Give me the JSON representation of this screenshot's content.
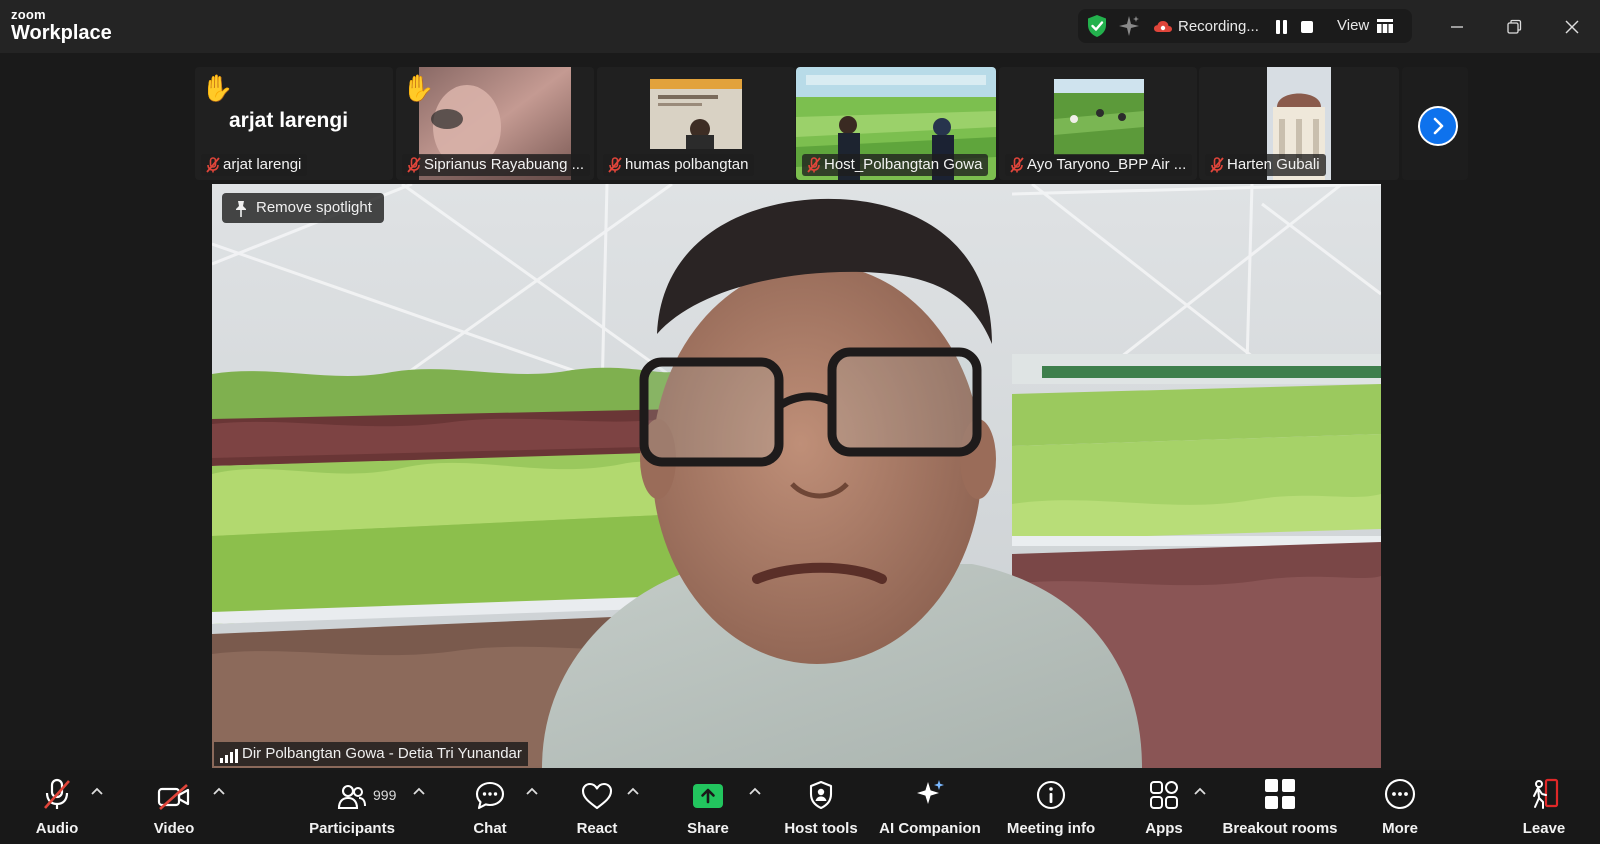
{
  "app": {
    "brand_small": "zoom",
    "brand_large": "Workplace"
  },
  "recording": {
    "status": "Recording...",
    "view_label": "View"
  },
  "filmstrip": {
    "tiles": [
      {
        "name": "arjat larengi",
        "display_name": "arjat larengi",
        "hand_raised": true,
        "muted": true
      },
      {
        "name": "Siprianus Rayabuang ...",
        "hand_raised": true,
        "muted": true
      },
      {
        "name": "humas polbangtan",
        "muted": true
      },
      {
        "name": "Host_Polbangtan Gowa",
        "muted": true
      },
      {
        "name": "Ayo Taryono_BPP Air ...",
        "muted": true
      },
      {
        "name": "Harten Gubali",
        "muted": true
      }
    ]
  },
  "main": {
    "spotlight_button": "Remove spotlight",
    "speaker_name": "Dir Polbangtan Gowa - Detia Tri Yunandar"
  },
  "toolbar": {
    "audio": "Audio",
    "video": "Video",
    "participants": "Participants",
    "participants_count": "999",
    "chat": "Chat",
    "react": "React",
    "share": "Share",
    "host_tools": "Host tools",
    "ai_companion": "AI Companion",
    "meeting_info": "Meeting info",
    "apps": "Apps",
    "breakout_rooms": "Breakout rooms",
    "more": "More",
    "leave": "Leave"
  },
  "colors": {
    "accent_blue": "#0e72ed",
    "share_green": "#22c55e",
    "leave_red": "#e02828",
    "muted_red": "#e0453a",
    "shield_green": "#23b14d",
    "hand_yellow": "#f7b500"
  }
}
